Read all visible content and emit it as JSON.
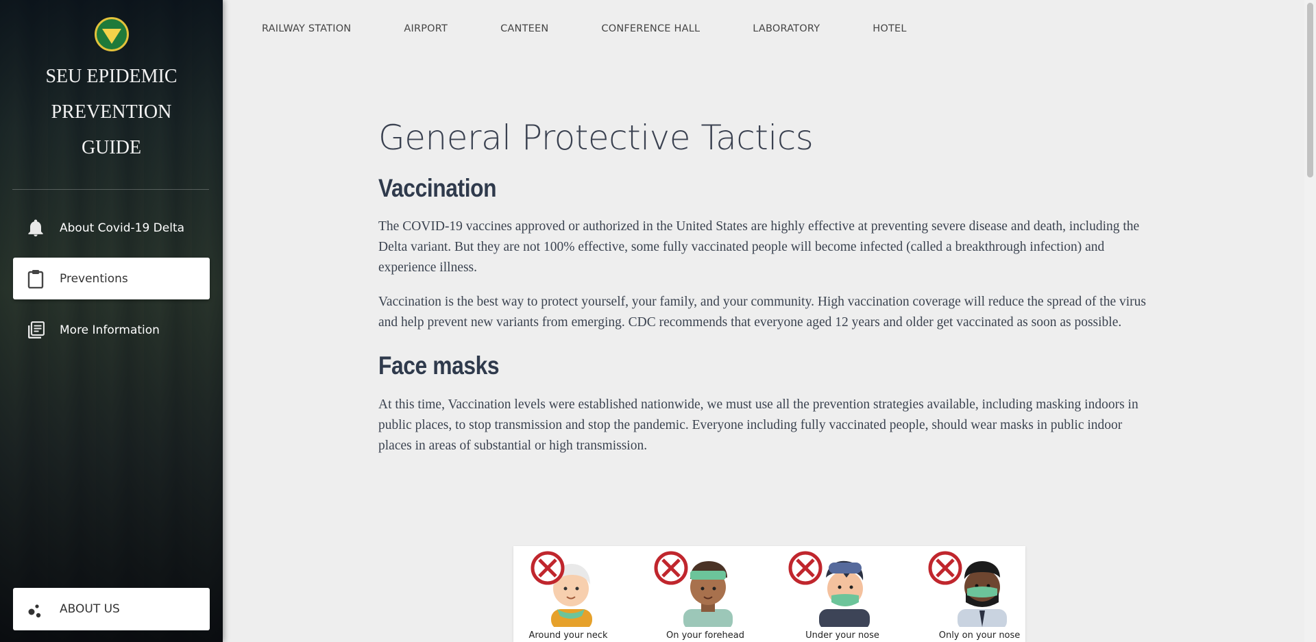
{
  "sidebar": {
    "title_lines": [
      "SEU EPIDEMIC",
      "PREVENTION",
      "GUIDE"
    ],
    "items": [
      {
        "label": "About Covid-19 Delta",
        "icon": "bell-icon"
      },
      {
        "label": "Preventions",
        "icon": "clipboard-icon"
      },
      {
        "label": "More Information",
        "icon": "library-books-icon"
      }
    ],
    "about_label": "ABOUT US"
  },
  "topnav": [
    "RAILWAY STATION",
    "AIRPORT",
    "CANTEEN",
    "CONFERENCE HALL",
    "LABORATORY",
    "HOTEL"
  ],
  "main": {
    "title": "General Protective Tactics",
    "sections": [
      {
        "heading": "Vaccination",
        "paragraphs": [
          "The COVID-19 vaccines approved or authorized in the United States are highly effective at preventing severe disease and death, including the Delta variant. But they are not 100% effective, some fully vaccinated people will become infected (called a breakthrough infection) and experience illness.",
          "Vaccination is the best way to protect yourself, your family, and your community. High vaccination coverage will reduce the spread of the virus and help prevent new variants from emerging. CDC recommends that everyone aged 12 years and older get vaccinated as soon as possible."
        ]
      },
      {
        "heading": "Face masks",
        "paragraphs": [
          "At this time, Vaccination levels were established nationwide, we must use all the prevention strategies available, including masking indoors in public places, to stop transmission and stop the pandemic. Everyone including fully vaccinated people, should wear masks in public indoor places in areas of substantial or high transmission."
        ]
      }
    ],
    "mask_captions": [
      "Around your neck",
      "On your forehead",
      "Under your nose",
      "Only on your nose"
    ]
  },
  "colors": {
    "wrong": "#c0262d",
    "mask": "#6cc49a"
  }
}
